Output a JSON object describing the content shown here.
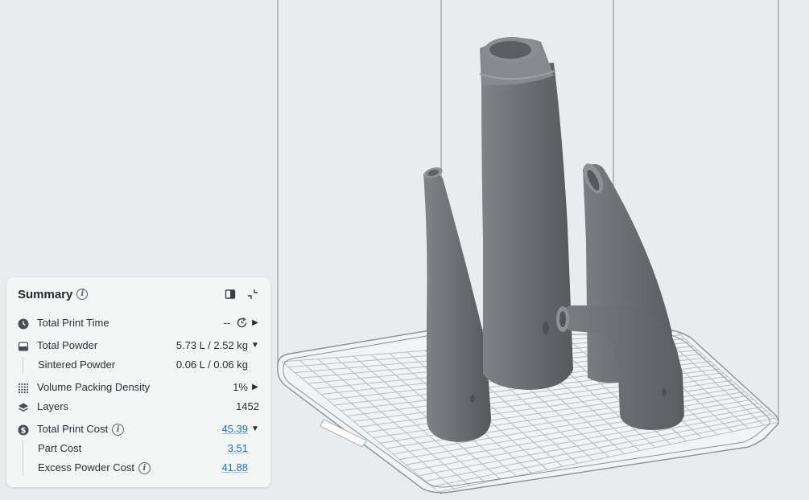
{
  "summary": {
    "title": "Summary",
    "rows": [
      {
        "label": "Total Print Time",
        "value": "--",
        "icon": "clock-icon",
        "arrow": "right"
      },
      {
        "label": "Total Powder",
        "value": "5.73 L / 2.52 kg",
        "icon": "powder-icon",
        "arrow": "down"
      },
      {
        "label": "Sintered Powder",
        "value": "0.06 L / 0.06 kg"
      },
      {
        "label": "Volume Packing Density",
        "value": "1%",
        "icon": "dots-grid-icon",
        "arrow": "right"
      },
      {
        "label": "Layers",
        "value": "1452",
        "icon": "layers-icon"
      },
      {
        "label": "Total Print Cost",
        "value": "45.39",
        "icon": "dollar-icon",
        "arrow": "down"
      },
      {
        "label": "Part Cost",
        "value": "3.51"
      },
      {
        "label": "Excess Powder Cost",
        "value": "41.88"
      }
    ]
  },
  "colors": {
    "panel": "#f4f6f6",
    "link": "#1f6fc5",
    "part": "#6b6e72",
    "build_plate_grid": "#bdbdbd",
    "background": "#e9ecee"
  }
}
